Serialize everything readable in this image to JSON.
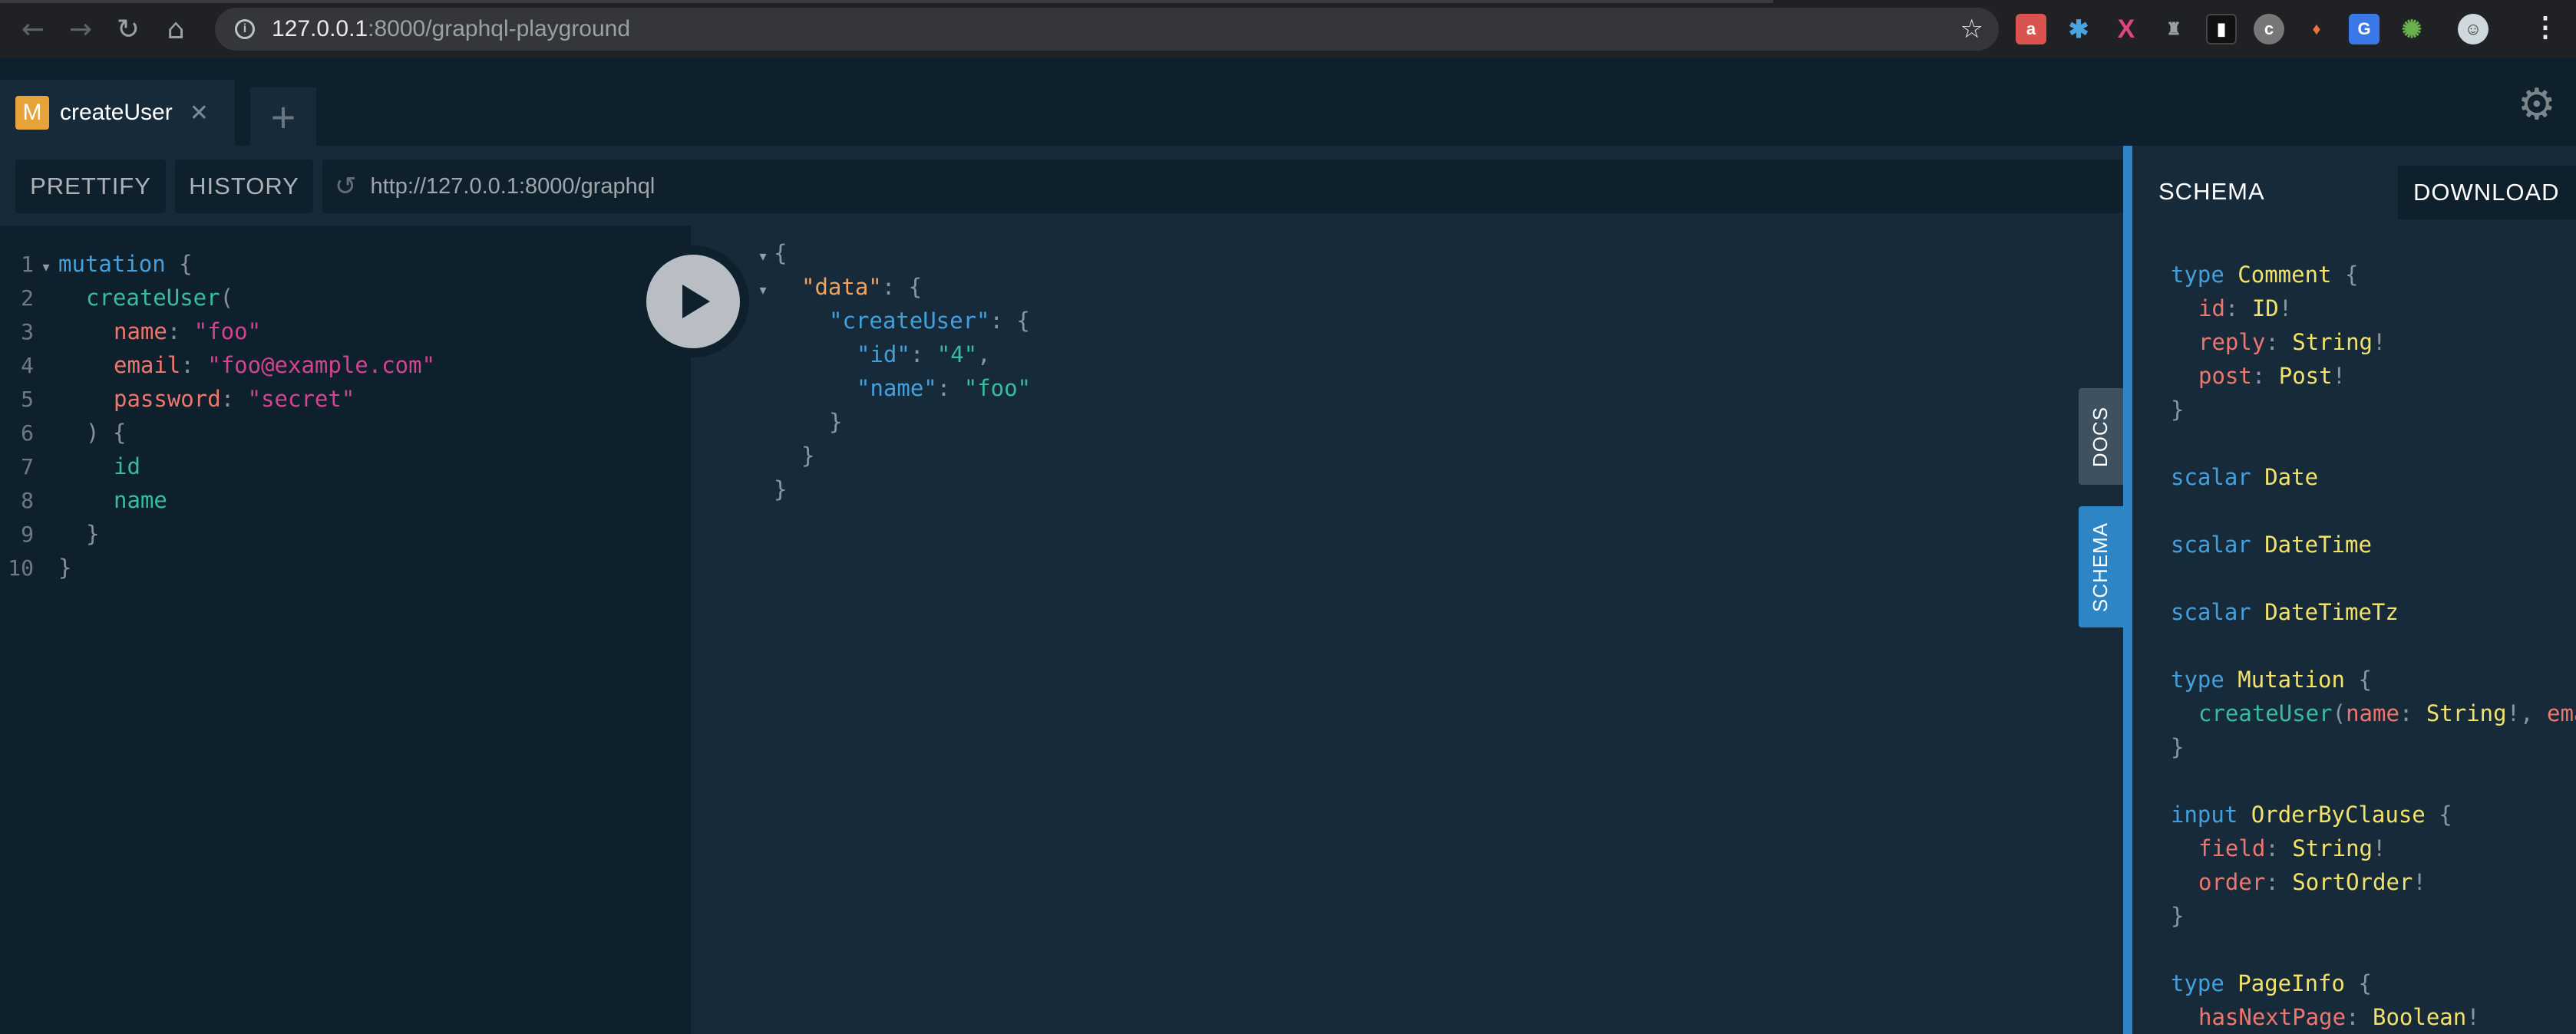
{
  "browser": {
    "url_host": "127.0.0.1",
    "url_path": ":8000/graphql-playground"
  },
  "tabs": [
    {
      "badge": "M",
      "title": "createUser",
      "close": "✕"
    }
  ],
  "new_tab_symbol": "+",
  "toolbar": {
    "prettify_label": "PRETTIFY",
    "history_label": "HISTORY",
    "endpoint": "http://127.0.0.1:8000/graphql"
  },
  "query_lines": [
    {
      "n": "1",
      "parts": [
        "mutation",
        " {"
      ]
    },
    {
      "n": "2",
      "parts": [
        "createUser",
        "("
      ]
    },
    {
      "n": "3",
      "parts": [
        "name",
        ": ",
        "\"foo\""
      ]
    },
    {
      "n": "4",
      "parts": [
        "email",
        ": ",
        "\"foo@example.com\""
      ]
    },
    {
      "n": "5",
      "parts": [
        "password",
        ": ",
        "\"secret\""
      ]
    },
    {
      "n": "6",
      "parts": [
        ") {"
      ]
    },
    {
      "n": "7",
      "parts": [
        "id"
      ]
    },
    {
      "n": "8",
      "parts": [
        "name"
      ]
    },
    {
      "n": "9",
      "parts": [
        "}"
      ]
    },
    {
      "n": "10",
      "parts": [
        "}"
      ]
    }
  ],
  "result_lines": [
    [
      "{"
    ],
    [
      "\"data\"",
      ": {"
    ],
    [
      "\"createUser\"",
      ": {"
    ],
    [
      "\"id\"",
      ": ",
      "\"4\"",
      ","
    ],
    [
      "\"name\"",
      ": ",
      "\"foo\""
    ],
    [
      "}"
    ],
    [
      "}"
    ],
    [
      "}"
    ]
  ],
  "side_tabs": {
    "docs": "DOCS",
    "schema": "SCHEMA"
  },
  "schema_panel": {
    "title": "SCHEMA",
    "download_label": "DOWNLOAD",
    "sdl_lines": [
      [
        "type",
        " Comment",
        " {"
      ],
      [
        "id",
        ": ",
        "ID",
        "!"
      ],
      [
        "reply",
        ": ",
        "String",
        "!"
      ],
      [
        "post",
        ": ",
        "Post",
        "!"
      ],
      [
        "}"
      ],
      [],
      [
        "scalar",
        " Date"
      ],
      [],
      [
        "scalar",
        " DateTime"
      ],
      [],
      [
        "scalar",
        " DateTimeTz"
      ],
      [],
      [
        "type",
        " Mutation",
        " {"
      ],
      [
        "createUser",
        "(",
        "name",
        ": ",
        "String",
        "!, ",
        "ema"
      ],
      [
        "}"
      ],
      [],
      [
        "input",
        " OrderByClause",
        " {"
      ],
      [
        "field",
        ": ",
        "String",
        "!"
      ],
      [
        "order",
        ": ",
        "SortOrder",
        "!"
      ],
      [
        "}"
      ],
      [],
      [
        "type",
        " PageInfo",
        " {"
      ],
      [
        "hasNextPage",
        ": ",
        "Boolean",
        "!"
      ]
    ]
  },
  "colors": {
    "bg": "#172a3a",
    "editor_bg": "#0f202d",
    "accent": "#2e85c6"
  }
}
